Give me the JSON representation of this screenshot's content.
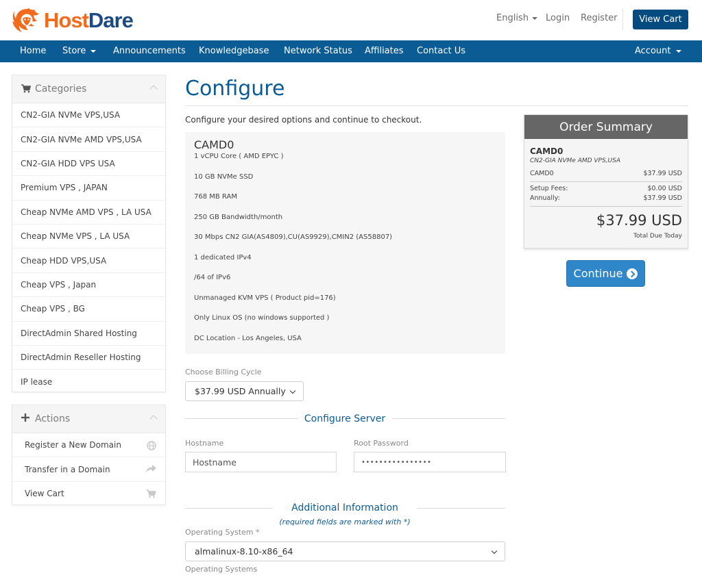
{
  "brand": {
    "name_part1": "Host",
    "name_part2": "Dare",
    "accent": "#f26b1d",
    "primary": "#0b5c94"
  },
  "header": {
    "language": "English",
    "login": "Login",
    "register": "Register",
    "view_cart": "View Cart"
  },
  "nav": {
    "items": [
      "Home",
      "Store",
      "Announcements",
      "Knowledgebase",
      "Network Status",
      "Affiliates",
      "Contact Us"
    ],
    "account": "Account"
  },
  "sidebar": {
    "categories_title": "Categories",
    "categories": [
      "CN2-GIA NVMe VPS,USA",
      "CN2-GIA NVMe AMD VPS,USA",
      "CN2-GIA HDD VPS USA",
      "Premium VPS , JAPAN",
      "Cheap NVMe AMD VPS , LA USA",
      "Cheap NVMe VPS , LA USA",
      "Cheap HDD VPS,USA",
      "Cheap VPS , Japan",
      "Cheap VPS , BG",
      "DirectAdmin Shared Hosting",
      "DirectAdmin Reseller Hosting",
      "IP lease"
    ],
    "actions_title": "Actions",
    "actions": [
      {
        "label": "Register a New Domain",
        "icon": "globe-icon"
      },
      {
        "label": "Transfer in a Domain",
        "icon": "share-arrow-icon"
      },
      {
        "label": "View Cart",
        "icon": "cart-icon"
      }
    ]
  },
  "main": {
    "title": "Configure",
    "intro": "Configure your desired options and continue to checkout.",
    "product": {
      "name": "CAMD0",
      "features": [
        "1 vCPU Core ( AMD EPYC )",
        "10 GB NVMe SSD",
        "768 MB RAM",
        "250 GB Bandwidth/month",
        "30 Mbps CN2 GIA(AS4809),CU(AS9929),CMIN2 (AS58807)",
        "1 dedicated IPv4",
        "/64 of IPv6",
        "Unmanaged KVM VPS ( Product pid=176)",
        "Only Linux OS (no windows supported )",
        "DC Location - Los Angeles, USA"
      ]
    },
    "billing_label": "Choose Billing Cycle",
    "billing_value": "$37.99 USD Annually",
    "configure_server_title": "Configure Server",
    "hostname_label": "Hostname",
    "hostname_placeholder": "Hostname",
    "root_password_label": "Root Password",
    "root_password_value": "••••••••••••••••",
    "additional_title": "Additional Information",
    "required_note": "(required fields are marked with *)",
    "os_label": "Operating System *",
    "os_value": "almalinux-8.10-x86_64",
    "os_help": "Operating Systems"
  },
  "summary": {
    "title": "Order Summary",
    "product": "CAMD0",
    "group": "CN2-GIA NVMe AMD VPS,USA",
    "line_label": "CAMD0",
    "line_value": "$37.99 USD",
    "setup_label": "Setup Fees:",
    "setup_value": "$0.00 USD",
    "annual_label": "Annually:",
    "annual_value": "$37.99 USD",
    "total": "$37.99 USD",
    "total_label": "Total Due Today",
    "continue": "Continue"
  }
}
